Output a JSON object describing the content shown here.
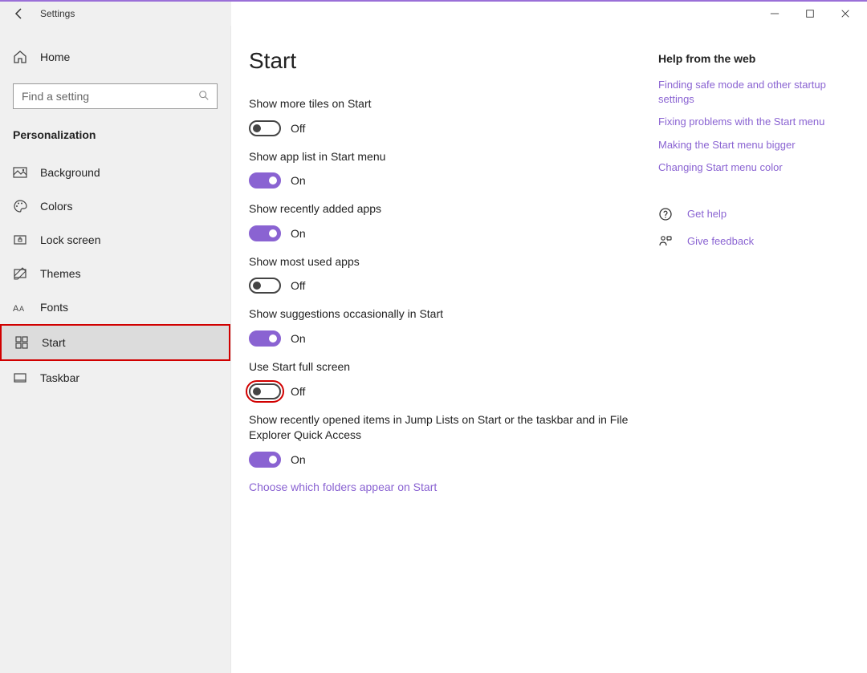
{
  "window": {
    "title": "Settings"
  },
  "sidebar": {
    "home_label": "Home",
    "search_placeholder": "Find a setting",
    "section_title": "Personalization",
    "items": [
      {
        "label": "Background"
      },
      {
        "label": "Colors"
      },
      {
        "label": "Lock screen"
      },
      {
        "label": "Themes"
      },
      {
        "label": "Fonts"
      },
      {
        "label": "Start"
      },
      {
        "label": "Taskbar"
      }
    ]
  },
  "page": {
    "title": "Start",
    "settings": [
      {
        "label": "Show more tiles on Start",
        "on": false,
        "state": "Off"
      },
      {
        "label": "Show app list in Start menu",
        "on": true,
        "state": "On"
      },
      {
        "label": "Show recently added apps",
        "on": true,
        "state": "On"
      },
      {
        "label": "Show most used apps",
        "on": false,
        "state": "Off"
      },
      {
        "label": "Show suggestions occasionally in Start",
        "on": true,
        "state": "On"
      },
      {
        "label": "Use Start full screen",
        "on": false,
        "state": "Off"
      },
      {
        "label": "Show recently opened items in Jump Lists on Start or the taskbar and in File Explorer Quick Access",
        "on": true,
        "state": "On"
      }
    ],
    "folders_link": "Choose which folders appear on Start"
  },
  "aside": {
    "help_title": "Help from the web",
    "links": [
      "Finding safe mode and other startup settings",
      "Fixing problems with the Start menu",
      "Making the Start menu bigger",
      "Changing Start menu color"
    ],
    "get_help": "Get help",
    "feedback": "Give feedback"
  }
}
